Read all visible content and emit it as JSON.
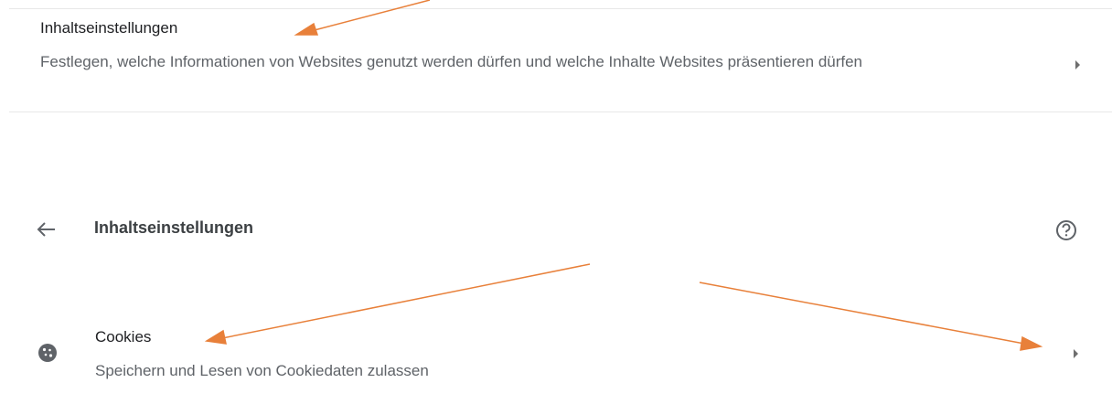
{
  "content_settings_row": {
    "title": "Inhaltseinstellungen",
    "subtitle": "Festlegen, welche Informationen von Websites genutzt werden dürfen und welche Inhalte Websites präsentieren dürfen",
    "icon": "chevron-right-icon"
  },
  "subpage_header": {
    "title": "Inhaltseinstellungen",
    "back_icon": "arrow-back-icon",
    "help_icon": "help-circle-icon"
  },
  "cookies_row": {
    "title": "Cookies",
    "subtitle": "Speichern und Lesen von Cookiedaten zulassen",
    "icon": "cookie-icon",
    "chevron_icon": "chevron-right-icon"
  },
  "annotation_color": "#e8803a"
}
